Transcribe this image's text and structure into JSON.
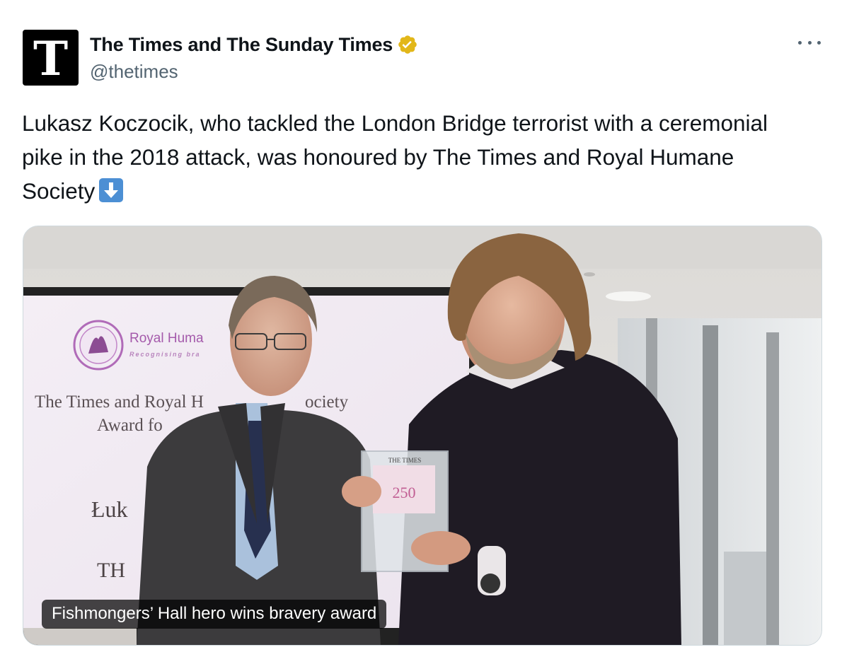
{
  "account": {
    "avatar_letter": "T",
    "display_name": "The Times and The Sunday Times",
    "handle": "@thetimes",
    "verified_color": "#e8b829"
  },
  "tweet": {
    "text": "Lukasz Koczocik, who tackled the London Bridge terrorist with a ceremonial pike in the 2018 attack, was honoured by The Times and Royal Humane Society",
    "emoji": "down-arrow-emoji"
  },
  "media": {
    "caption": "Fishmongers’ Hall hero wins bravery award",
    "screen": {
      "logo_text": "Royal Huma",
      "logo_tagline": "Recognising bra",
      "line1": "The Times and Royal H",
      "line1b": "ociety",
      "line2": "Award fo",
      "line3": "Łuk",
      "line4": "TH"
    },
    "award": {
      "header": "THE TIMES",
      "number": "250"
    }
  },
  "icons": {
    "more": "more-options-icon",
    "verified": "verified-badge-icon"
  }
}
